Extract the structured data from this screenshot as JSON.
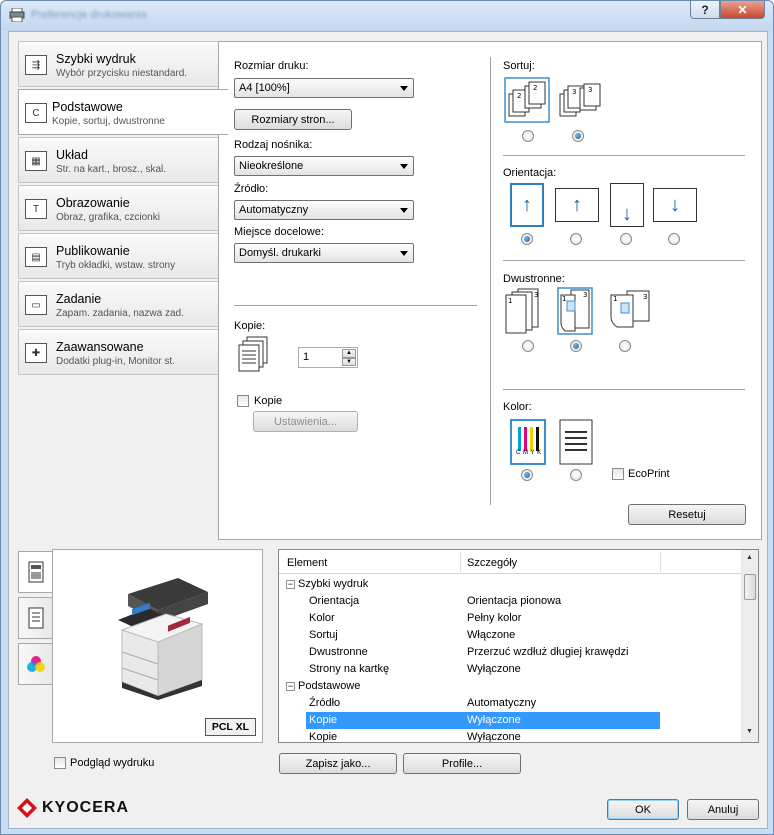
{
  "window": {
    "title": "Preferencje drukowania",
    "help_label": "?",
    "close_label": "✕"
  },
  "nav": [
    {
      "title": "Szybki wydruk",
      "sub": "Wybór przycisku niestandard.",
      "icon": "quick-print-icon"
    },
    {
      "title": "Podstawowe",
      "sub": "Kopie, sortuj, dwustronne",
      "icon": "basic-icon"
    },
    {
      "title": "Układ",
      "sub": "Str. na kart., brosz., skal.",
      "icon": "layout-icon"
    },
    {
      "title": "Obrazowanie",
      "sub": "Obraz, grafika, czcionki",
      "icon": "imaging-icon"
    },
    {
      "title": "Publikowanie",
      "sub": "Tryb okładki, wstaw. strony",
      "icon": "publishing-icon"
    },
    {
      "title": "Zadanie",
      "sub": "Zapam. zadania, nazwa zad.",
      "icon": "job-icon"
    },
    {
      "title": "Zaawansowane",
      "sub": "Dodatki plug-in, Monitor st.",
      "icon": "advanced-icon"
    }
  ],
  "basic": {
    "print_size_label": "Rozmiar druku:",
    "print_size_value": "A4  [100%]",
    "page_sizes_button": "Rozmiary stron...",
    "media_type_label": "Rodzaj nośnika:",
    "media_type_value": "Nieokreślone",
    "source_label": "Źródło:",
    "source_value": "Automatyczny",
    "destination_label": "Miejsce docelowe:",
    "destination_value": "Domyśl. drukarki",
    "copies_label": "Kopie:",
    "copies_value": "1",
    "copies_check_label": "Kopie",
    "settings_button": "Ustawienia...",
    "collate_label": "Sortuj:",
    "orientation_label": "Orientacja:",
    "duplex_label": "Dwustronne:",
    "color_label": "Kolor:",
    "ecoprint_label": "EcoPrint",
    "cmyk_label": "C M Y K",
    "reset_button": "Resetuj"
  },
  "preview": {
    "pcl_badge": "PCL XL",
    "print_preview_label": "Podgląd wydruku"
  },
  "grid": {
    "col_element": "Element",
    "col_details": "Szczegóły",
    "rows": [
      {
        "key": "Szybki wydruk",
        "value": "",
        "group": true
      },
      {
        "key": "Orientacja",
        "value": "Orientacja pionowa"
      },
      {
        "key": "Kolor",
        "value": "Pełny kolor"
      },
      {
        "key": "Sortuj",
        "value": "Włączone"
      },
      {
        "key": "Dwustronne",
        "value": "Przerzuć wzdłuż długiej krawędzi"
      },
      {
        "key": "Strony na kartkę",
        "value": "Wyłączone"
      },
      {
        "key": "Podstawowe",
        "value": "",
        "group": true
      },
      {
        "key": "Źródło",
        "value": "Automatyczny"
      },
      {
        "key": "Kopie",
        "value": "Wyłączone",
        "selected": true
      },
      {
        "key": "Kopie",
        "value": "Wyłączone"
      }
    ]
  },
  "bottom": {
    "save_as_button": "Zapisz jako...",
    "profile_button": "Profile...",
    "ok_button": "OK",
    "cancel_button": "Anuluj",
    "brand": "KYOCERA"
  },
  "colors": {
    "accent": "#3399ff",
    "brand_red": "#d5131c"
  }
}
